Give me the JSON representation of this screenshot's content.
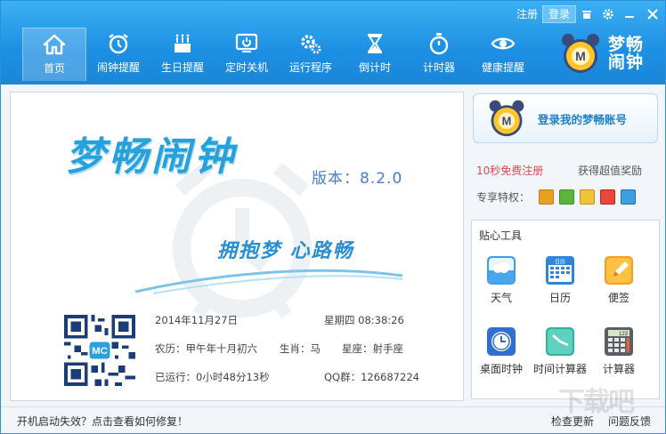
{
  "top_controls": {
    "register": "注册",
    "login": "登录"
  },
  "nav": [
    {
      "label": "首页",
      "icon": "home-icon"
    },
    {
      "label": "闹钟提醒",
      "icon": "alarm-clock-icon"
    },
    {
      "label": "生日提醒",
      "icon": "birthday-cake-icon"
    },
    {
      "label": "定时关机",
      "icon": "power-icon"
    },
    {
      "label": "运行程序",
      "icon": "gears-icon"
    },
    {
      "label": "倒计时",
      "icon": "hourglass-icon"
    },
    {
      "label": "计时器",
      "icon": "stopwatch-icon"
    },
    {
      "label": "健康提醒",
      "icon": "eye-icon"
    }
  ],
  "brand": {
    "line1": "梦畅",
    "line2": "闹钟"
  },
  "main": {
    "app_title": "梦畅闹钟",
    "version": "版本：8.2.0",
    "slogan": "拥抱梦  心路畅",
    "date": "2014年11月27日",
    "weekday_time": "星期四 08:38:26",
    "lunar": "农历：甲午年十月初六",
    "zodiac": "生肖：马",
    "constellation": "星座：射手座",
    "uptime": "已运行：0小时48分13秒",
    "qq_group": "QQ群：126687224"
  },
  "account": {
    "login_text": "登录我的梦畅账号"
  },
  "promo": {
    "register_free": "10秒免费注册",
    "reward": "获得超值奖励",
    "privileges_label": "专享特权："
  },
  "tools": {
    "title": "贴心工具",
    "items": [
      {
        "label": "天气",
        "icon": "weather-icon"
      },
      {
        "label": "日历",
        "icon": "calendar-icon"
      },
      {
        "label": "便签",
        "icon": "notepad-icon"
      },
      {
        "label": "桌面时钟",
        "icon": "desktop-clock-icon"
      },
      {
        "label": "时间计算器",
        "icon": "time-calculator-icon"
      },
      {
        "label": "计算器",
        "icon": "calculator-icon"
      }
    ]
  },
  "status": {
    "message": "开机启动失效？点击查看如何修复！",
    "check_update": "检查更新",
    "feedback": "问题反馈"
  },
  "watermark": "下载吧"
}
